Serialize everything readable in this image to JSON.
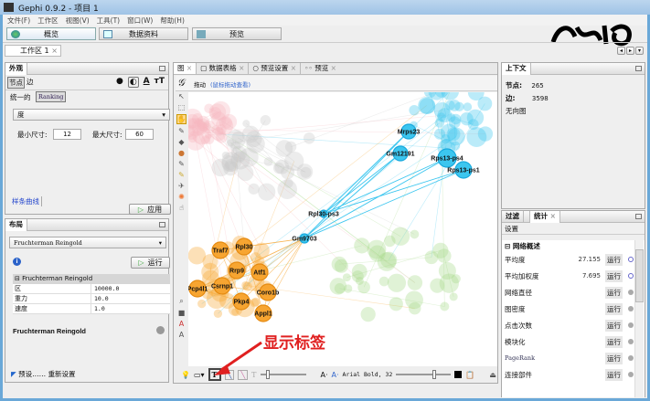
{
  "window": {
    "title": "Gephi 0.9.2 - 项目 1"
  },
  "menu": [
    "文件(F)",
    "工作区",
    "视图(V)",
    "工具(T)",
    "窗口(W)",
    "帮助(H)"
  ],
  "modes": [
    {
      "label": "概览"
    },
    {
      "label": "数据资料"
    },
    {
      "label": "预览"
    }
  ],
  "workspace_tab": {
    "label": "工作区 1"
  },
  "appearance": {
    "title": "外观",
    "tabs": [
      "节点",
      "边"
    ],
    "unique_label": "统一的",
    "ranking_label": "Ranking",
    "attribute": "度",
    "min_label": "最小尺寸:",
    "min_value": "12",
    "max_label": "最大尺寸:",
    "max_value": "60",
    "spline_label": "样条曲线",
    "apply_label": "应用"
  },
  "layout": {
    "title": "布局",
    "algorithm": "Fruchterman Reingold",
    "run_label": "运行",
    "group": "Fruchterman Reingold",
    "props": [
      {
        "name": "区",
        "value": "10000.0"
      },
      {
        "name": "重力",
        "value": "10.0"
      },
      {
        "name": "速度",
        "value": "1.0"
      }
    ],
    "desc_title": "Fruchterman Reingold",
    "presets_label": "预设……",
    "reset_label": "重新设置"
  },
  "center_tabs": [
    "图",
    "数据表格",
    "预览设置",
    "预览"
  ],
  "graph_header": {
    "drag_label": "拖动",
    "hint": "(鼠标拖动查看)"
  },
  "nodes": {
    "orange": [
      "Traf7",
      "Rpl30",
      "Rrp9",
      "Atf1",
      "Csrnp1",
      "Pcp4l1",
      "Coro1b",
      "Pkp4",
      "Appl1"
    ],
    "cyan": [
      "Gm9703",
      "Rpl30-ps3",
      "Gm12191",
      "Mrps23",
      "Rps13-ps4",
      "Rps13-ps1"
    ]
  },
  "bottom_toolbar": {
    "font": "Arial Bold, 32"
  },
  "annotation": {
    "text": "显示标签",
    "color": "#e02020"
  },
  "context": {
    "title": "上下文",
    "nodes_label": "节点:",
    "nodes_value": "265",
    "edges_label": "边:",
    "edges_value": "3598",
    "graph_type": "无向图"
  },
  "stats": {
    "tabs": [
      "过滤",
      "统计"
    ],
    "settings_label": "设置",
    "group": "网络概述",
    "run_label": "运行",
    "items": [
      {
        "name": "平均度",
        "value": "27.155"
      },
      {
        "name": "平均加权度",
        "value": "7.695"
      },
      {
        "name": "网络直径",
        "value": ""
      },
      {
        "name": "图密度",
        "value": ""
      },
      {
        "name": "点击次数",
        "value": ""
      },
      {
        "name": "模块化",
        "value": ""
      },
      {
        "name": "PageRank",
        "value": ""
      },
      {
        "name": "连接部件",
        "value": ""
      }
    ]
  },
  "colors": {
    "orange": "#f7a531",
    "cyan": "#3cc6ef",
    "green": "#a6d98a",
    "gray": "#c8c8c8"
  }
}
